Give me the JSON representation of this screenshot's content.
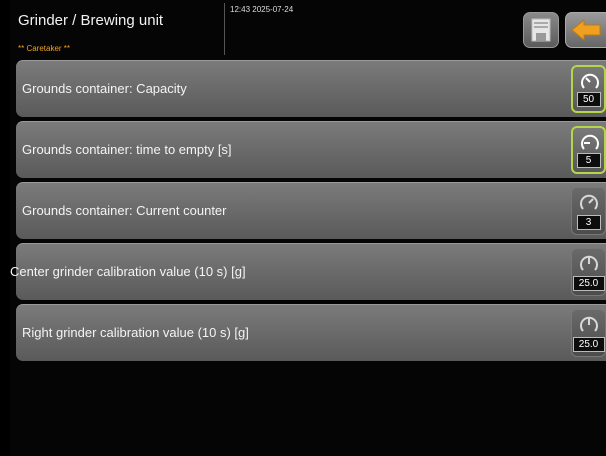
{
  "header": {
    "title": "Grinder / Brewing unit",
    "role": "** Caretaker **",
    "datetime": "12:43 2025-07-24",
    "save_icon": "save-icon",
    "back_icon": "back-arrow-icon"
  },
  "rows": [
    {
      "label": "Grounds container: Capacity",
      "value": "50",
      "active": true
    },
    {
      "label": "Grounds container: time to empty [s]",
      "value": "5",
      "active": true
    },
    {
      "label": "Grounds container: Current counter",
      "value": "3",
      "active": false
    },
    {
      "label": "Center grinder calibration value (10 s) [g]",
      "value": "25.0",
      "active": false
    },
    {
      "label": "Right grinder calibration value (10 s) [g]",
      "value": "25.0",
      "active": false
    }
  ],
  "colors": {
    "accent": "#f0a020",
    "active_border": "#b6d64a",
    "back_arrow": "#f0a020"
  }
}
